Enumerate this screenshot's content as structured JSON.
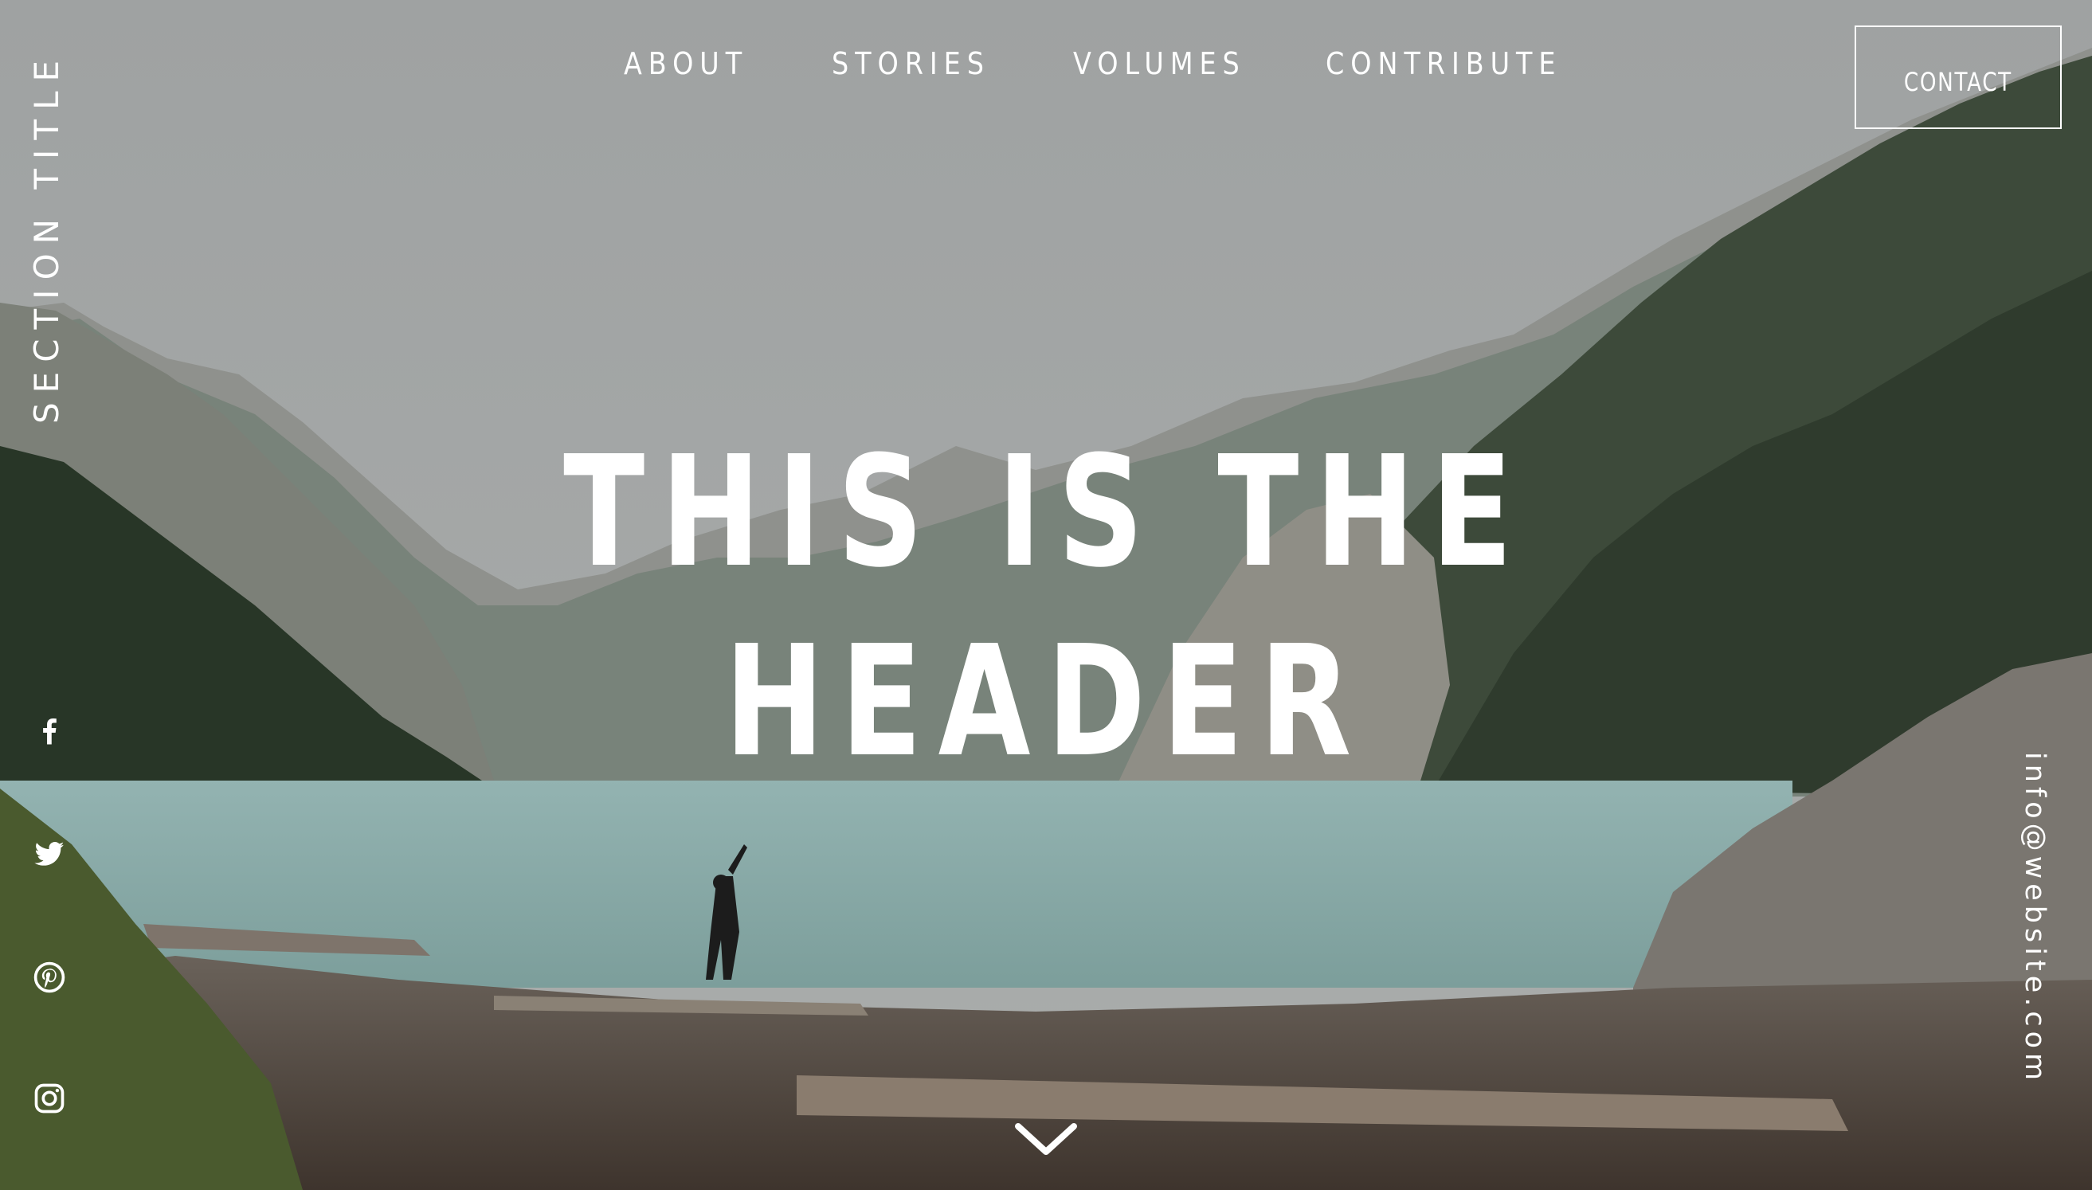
{
  "nav": {
    "items": [
      {
        "label": "ABOUT"
      },
      {
        "label": "STORIES"
      },
      {
        "label": "VOLUMES"
      },
      {
        "label": "CONTRIBUTE"
      }
    ],
    "contact_label": "CONTACT"
  },
  "side": {
    "section_title": "SECTION TITLE",
    "email": "info@website.com"
  },
  "hero": {
    "headline_line1": "THIS IS THE",
    "headline_line2": "HEADER"
  },
  "social": {
    "icons": [
      "facebook-icon",
      "twitter-icon",
      "pinterest-icon",
      "instagram-icon"
    ]
  },
  "scroll_icon": "chevron-down-icon",
  "colors": {
    "text": "#ffffff",
    "sky": "#a1a4a4",
    "lake": "#88aba9",
    "forest": "#2f3a2c",
    "rock": "#6c6259"
  }
}
